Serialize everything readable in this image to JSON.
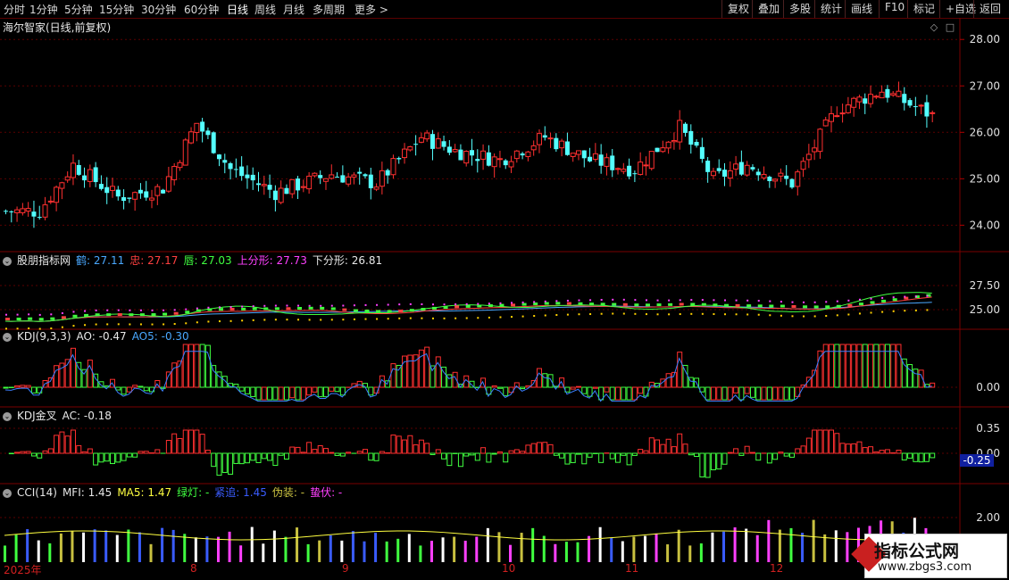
{
  "toolbar": {
    "timeframes": [
      "分时",
      "1分钟",
      "5分钟",
      "15分钟",
      "30分钟",
      "60分钟",
      "日线",
      "周线",
      "月线",
      "多周期",
      "更多 >"
    ],
    "active": "日线",
    "right_buttons": [
      "复权",
      "叠加",
      "多股",
      "统计",
      "画线",
      "F10",
      "标记",
      "+自选",
      "返回"
    ]
  },
  "main": {
    "title": "海尔智家(日线,前复权)",
    "y_axis": [
      "28.00",
      "27.00",
      "26.00",
      "25.00",
      "24.00"
    ],
    "colors": {
      "up": "#ff3030",
      "down": "#54ffff",
      "grid": "#5a0000"
    }
  },
  "panel1": {
    "name": "股朋指标网",
    "items": [
      {
        "label": "鹤:",
        "value": "27.11",
        "color": "#4aa8ff"
      },
      {
        "label": "忠:",
        "value": "27.17",
        "color": "#ff4040"
      },
      {
        "label": "唇:",
        "value": "27.03",
        "color": "#40ff40"
      },
      {
        "label": "上分形:",
        "value": "27.73",
        "color": "#ff40ff"
      },
      {
        "label": "下分形:",
        "value": "26.81",
        "color": "#e8e8e8"
      }
    ],
    "y_axis": [
      "27.50",
      "25.00"
    ]
  },
  "panel2": {
    "name": "KDJ(9,3,3)",
    "items": [
      {
        "label": "AO:",
        "value": "-0.47",
        "color": "#e8e8e8"
      },
      {
        "label": "AO5:",
        "value": "-0.30",
        "color": "#4aa8ff"
      }
    ],
    "y_axis": [
      "0.00"
    ]
  },
  "panel3": {
    "name": "KDJ金叉",
    "items": [
      {
        "label": "AC:",
        "value": "-0.18",
        "color": "#e8e8e8"
      }
    ],
    "y_axis": [
      "0.35",
      "0.00"
    ],
    "marker": "-0.25"
  },
  "panel4": {
    "name": "CCI(14)",
    "items": [
      {
        "label": "MFI:",
        "value": "1.45",
        "color": "#e8e8e8"
      },
      {
        "label": "MA5:",
        "value": "1.47",
        "color": "#ffff40"
      },
      {
        "label": "绿灯:",
        "value": "-",
        "color": "#40ff40"
      },
      {
        "label": "紧追:",
        "value": "1.45",
        "color": "#3a5cff"
      },
      {
        "label": "伪装:",
        "value": "-",
        "color": "#c8c040"
      },
      {
        "label": "蛰伏:",
        "value": "-",
        "color": "#ff40ff"
      }
    ],
    "y_axis": [
      "2.00"
    ]
  },
  "x_axis": [
    "2025年",
    "8",
    "9",
    "10",
    "11",
    "12"
  ],
  "watermark": {
    "title": "指标公式网",
    "url": "www.zbgs3.com"
  }
}
